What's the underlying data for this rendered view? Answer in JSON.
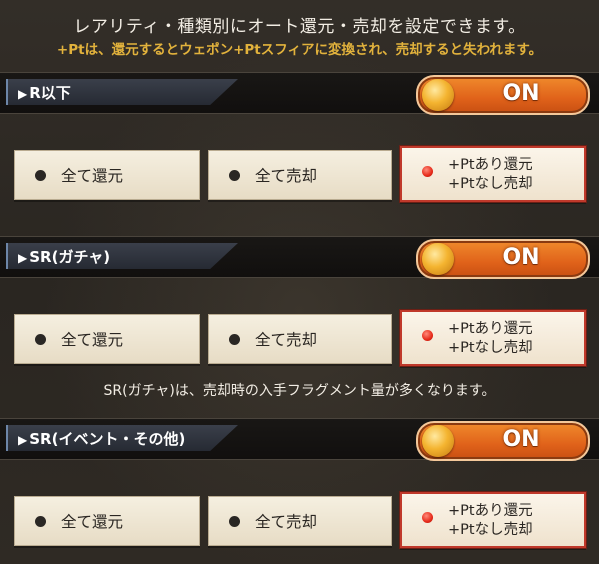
{
  "header": {
    "line1": "レアリティ・種類別にオート還元・売却を設定できます。",
    "line2": "+Ptは、還元するとウェポン+Ptスフィアに変換され、売却すると失われます。"
  },
  "sections": [
    {
      "label": "R以下",
      "toggle": "ON",
      "options": [
        "全て還元",
        "全て売却"
      ],
      "selected": {
        "line1": "+Ptあり還元",
        "line2": "+Ptなし売却"
      }
    },
    {
      "label": "SR(ガチャ)",
      "toggle": "ON",
      "options": [
        "全て還元",
        "全て売却"
      ],
      "selected": {
        "line1": "+Ptあり還元",
        "line2": "+Ptなし売却"
      }
    },
    {
      "label": "SR(イベント・その他)",
      "toggle": "ON",
      "options": [
        "全て還元",
        "全て売却"
      ],
      "selected": {
        "line1": "+Ptあり還元",
        "line2": "+Ptなし売却"
      }
    }
  ],
  "note": "SR(ガチャ)は、売却時の入手フラグメント量が多くなります。",
  "colors": {
    "accent_orange": "#e0621a",
    "header_gold": "#e2b23c",
    "selected_border": "#c0392b"
  },
  "icons": {
    "section_arrow": "play-arrow-icon",
    "radio_off": "radio-dot-icon",
    "radio_on": "radio-selected-icon",
    "toggle_knob": "toggle-knob-icon"
  }
}
